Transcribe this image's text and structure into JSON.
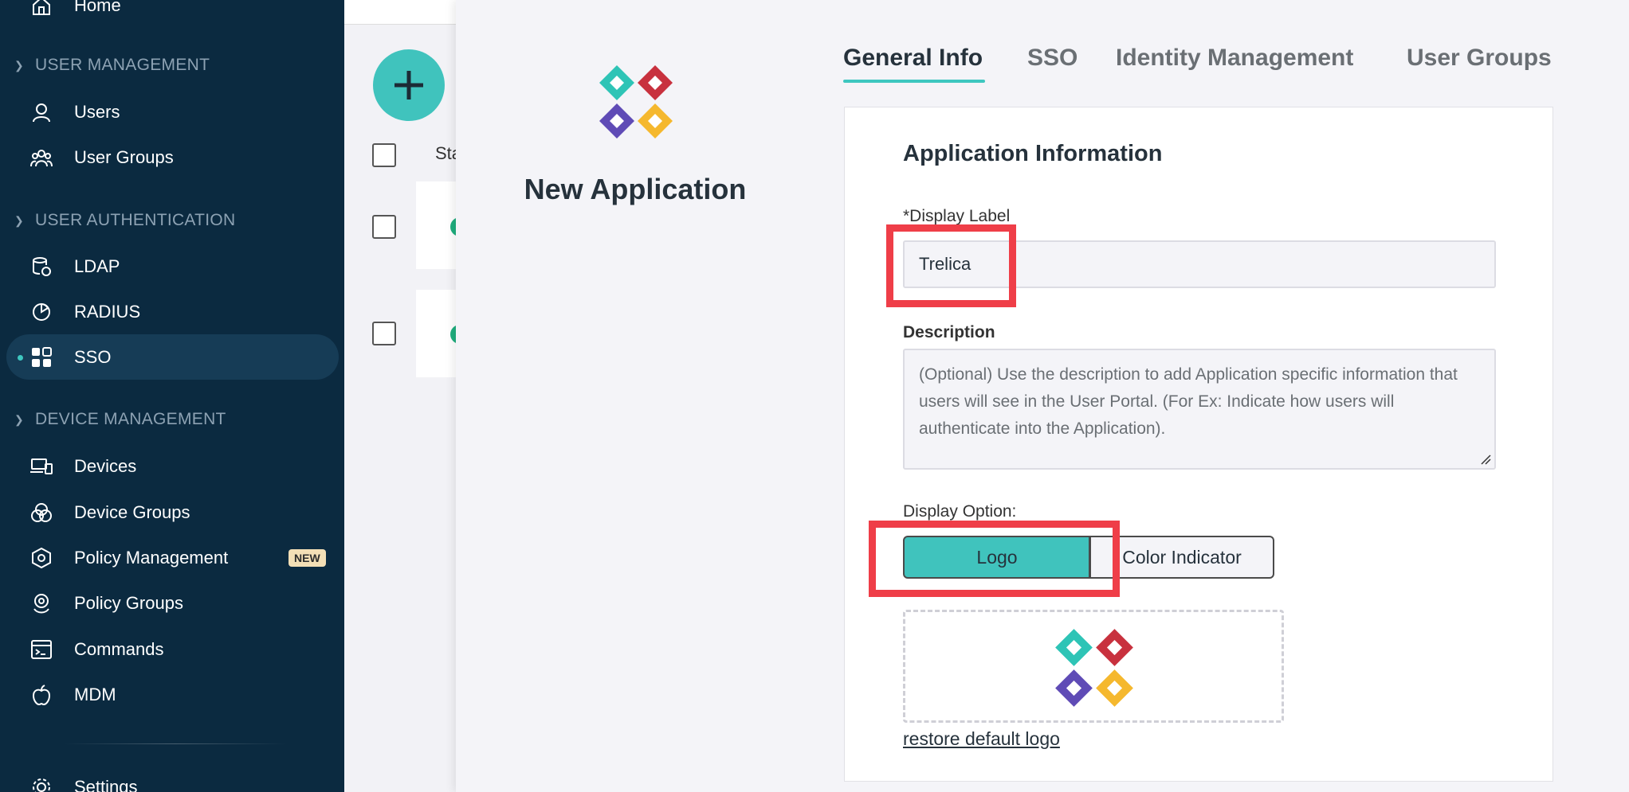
{
  "sidebar": {
    "items": [
      {
        "label": "Home",
        "icon": "home-icon"
      },
      {
        "label": "Users",
        "icon": "user-icon"
      },
      {
        "label": "User Groups",
        "icon": "user-groups-icon"
      },
      {
        "label": "LDAP",
        "icon": "ldap-icon"
      },
      {
        "label": "RADIUS",
        "icon": "radius-icon"
      },
      {
        "label": "SSO",
        "icon": "sso-grid-icon"
      },
      {
        "label": "Devices",
        "icon": "devices-icon"
      },
      {
        "label": "Device Groups",
        "icon": "device-groups-icon"
      },
      {
        "label": "Policy Management",
        "icon": "policy-icon"
      },
      {
        "label": "Policy Groups",
        "icon": "policy-groups-icon"
      },
      {
        "label": "Commands",
        "icon": "commands-icon"
      },
      {
        "label": "MDM",
        "icon": "apple-icon"
      },
      {
        "label": "Settings",
        "icon": "settings-icon"
      }
    ],
    "sections": [
      "USER MANAGEMENT",
      "USER AUTHENTICATION",
      "DEVICE MANAGEMENT"
    ],
    "badge": "NEW",
    "active_item": "SSO"
  },
  "list": {
    "status_header": "Sta"
  },
  "panel": {
    "app_title": "New Application",
    "tabs": [
      "General Info",
      "SSO",
      "Identity Management",
      "User Groups"
    ],
    "active_tab": "General Info",
    "section_title": "Application Information",
    "display_label": {
      "label": "*Display Label",
      "value": "Trelica"
    },
    "description": {
      "label": "Description",
      "placeholder": "(Optional) Use the description to add Application specific information that users will see in the User Portal. (For Ex: Indicate how users will authenticate into the Application)."
    },
    "display_option": {
      "label": "Display Option:",
      "options": [
        "Logo",
        "Color Indicator"
      ],
      "selected": "Logo"
    },
    "restore_link": "restore default logo"
  },
  "colors": {
    "sidebar_bg": "#0b2a40",
    "accent": "#40c3bd",
    "highlight": "#ef3e48",
    "logo_teal": "#2ec4b6",
    "logo_red": "#c8313e",
    "logo_purple": "#5f4bb6",
    "logo_yellow": "#f5b82e"
  }
}
